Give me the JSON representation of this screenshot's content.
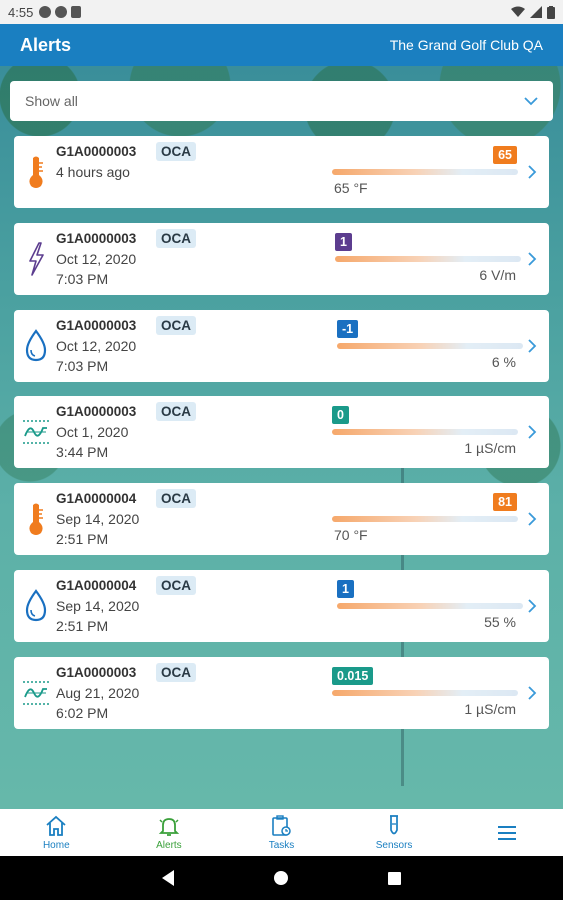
{
  "status_bar": {
    "time": "4:55"
  },
  "header": {
    "title": "Alerts",
    "subtitle": "The Grand Golf Club QA"
  },
  "filter": {
    "value": "Show all"
  },
  "alerts": [
    {
      "sensor_id": "G1A0000003",
      "tag": "OCA",
      "time_line1": "4 hours ago",
      "time_line2": "",
      "value": "65",
      "value_color": "#f07c1e",
      "unit_text": "65 °F",
      "icon": "thermometer-icon"
    },
    {
      "sensor_id": "G1A0000003",
      "tag": "OCA",
      "time_line1": "Oct 12, 2020",
      "time_line2": "7:03 PM",
      "value": "1",
      "value_color": "#5c3d8f",
      "unit_text": "6 V/m",
      "icon": "lightning-icon"
    },
    {
      "sensor_id": "G1A0000003",
      "tag": "OCA",
      "time_line1": "Oct 12, 2020",
      "time_line2": "7:03 PM",
      "value": "-1",
      "value_color": "#1a70c1",
      "unit_text": "6 %",
      "icon": "water-drop-icon"
    },
    {
      "sensor_id": "G1A0000003",
      "tag": "OCA",
      "time_line1": "Oct 1, 2020",
      "time_line2": "3:44 PM",
      "value": "0",
      "value_color": "#1a9a8a",
      "unit_text": "1 µS/cm",
      "icon": "conductivity-icon"
    },
    {
      "sensor_id": "G1A0000004",
      "tag": "OCA",
      "time_line1": "Sep 14, 2020",
      "time_line2": "2:51 PM",
      "value": "81",
      "value_color": "#f07c1e",
      "unit_text": "70 °F",
      "icon": "thermometer-icon"
    },
    {
      "sensor_id": "G1A0000004",
      "tag": "OCA",
      "time_line1": "Sep 14, 2020",
      "time_line2": "2:51 PM",
      "value": "1",
      "value_color": "#1a70c1",
      "unit_text": "55 %",
      "icon": "water-drop-icon"
    },
    {
      "sensor_id": "G1A0000003",
      "tag": "OCA",
      "time_line1": "Aug 21, 2020",
      "time_line2": "6:02 PM",
      "value": "0.015",
      "value_color": "#1a9a8a",
      "unit_text": "1 µS/cm",
      "icon": "conductivity-icon"
    }
  ],
  "bottom_nav": [
    {
      "label": "Home",
      "icon": "home-icon"
    },
    {
      "label": "Alerts",
      "icon": "bell-icon"
    },
    {
      "label": "Tasks",
      "icon": "tasks-icon"
    },
    {
      "label": "Sensors",
      "icon": "sensor-probe-icon"
    },
    {
      "label": "",
      "icon": "menu-icon"
    }
  ],
  "accent_color": "#1a7fc1"
}
